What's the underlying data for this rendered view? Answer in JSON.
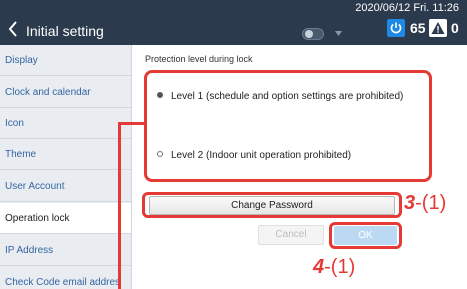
{
  "header": {
    "title": "Initial setting",
    "datetime": "2020/06/12 Fri. 11:26",
    "power_count": "65",
    "alert_count": "0",
    "colors": {
      "background": "#2b3a4d",
      "accent": "#1e88e5"
    }
  },
  "sidebar": {
    "items": [
      {
        "label": "Display"
      },
      {
        "label": "Clock and calendar"
      },
      {
        "label": "Icon"
      },
      {
        "label": "Theme"
      },
      {
        "label": "User Account"
      },
      {
        "label": "Operation lock",
        "active": true
      },
      {
        "label": "IP Address"
      },
      {
        "label": "Check Code email addres"
      }
    ]
  },
  "main": {
    "section_label": "Protection level during lock",
    "options": [
      {
        "label": "Level 1 (schedule and option settings are prohibited)",
        "selected": true
      },
      {
        "label": "Level 2 (Indoor unit operation prohibited)",
        "selected": false
      }
    ],
    "change_password_label": "Change Password",
    "cancel_label": "Cancel",
    "ok_label": "OK"
  },
  "annotations": {
    "step3_number": "3",
    "step3_suffix": "-(1)",
    "step4_number": "4",
    "step4_suffix": "-(1)",
    "highlight_color": "#e53935"
  }
}
